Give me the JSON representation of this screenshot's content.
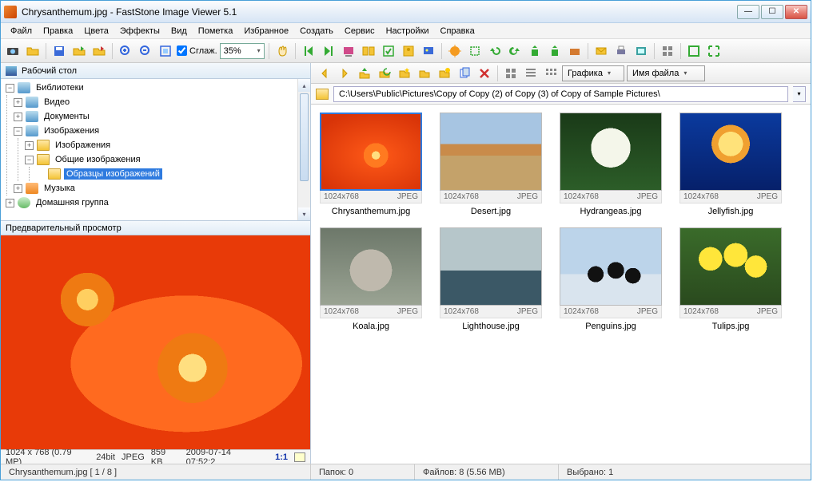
{
  "title": "Chrysanthemum.jpg  -  FastStone Image Viewer 5.1",
  "menu": [
    "Файл",
    "Правка",
    "Цвета",
    "Эффекты",
    "Вид",
    "Пометка",
    "Избранное",
    "Создать",
    "Сервис",
    "Настройки",
    "Справка"
  ],
  "toolbar": {
    "smooth_label": "Сглаж.",
    "zoom_pct": "35%"
  },
  "tree": {
    "root": "Рабочий стол",
    "lib": "Библиотеки",
    "video": "Видео",
    "docs": "Документы",
    "images": "Изображения",
    "images2": "Изображения",
    "shared_images": "Общие изображения",
    "samples": "Образцы изображений",
    "music": "Музыка",
    "homegroup": "Домашняя группа"
  },
  "preview_header": "Предварительный просмотр",
  "info": {
    "dims": "1024 x 768 (0.79 MP)",
    "depth": "24bit",
    "fmt": "JPEG",
    "size": "859 KB",
    "date": "2009-07-14 07:52:2",
    "ratio": "1:1"
  },
  "right_toolbar": {
    "view_combo": "Графика",
    "sort_combo": "Имя файла"
  },
  "address": "C:\\Users\\Public\\Pictures\\Copy of Copy (2) of Copy (3) of Copy of Sample Pictures\\",
  "thumbs": [
    {
      "name": "Chrysanthemum.jpg",
      "dims": "1024x768",
      "fmt": "JPEG",
      "bg": "bg-chrys",
      "sel": true
    },
    {
      "name": "Desert.jpg",
      "dims": "1024x768",
      "fmt": "JPEG",
      "bg": "bg-desert"
    },
    {
      "name": "Hydrangeas.jpg",
      "dims": "1024x768",
      "fmt": "JPEG",
      "bg": "bg-hydr"
    },
    {
      "name": "Jellyfish.jpg",
      "dims": "1024x768",
      "fmt": "JPEG",
      "bg": "bg-jelly"
    },
    {
      "name": "Koala.jpg",
      "dims": "1024x768",
      "fmt": "JPEG",
      "bg": "bg-koala"
    },
    {
      "name": "Lighthouse.jpg",
      "dims": "1024x768",
      "fmt": "JPEG",
      "bg": "bg-light"
    },
    {
      "name": "Penguins.jpg",
      "dims": "1024x768",
      "fmt": "JPEG",
      "bg": "bg-peng"
    },
    {
      "name": "Tulips.jpg",
      "dims": "1024x768",
      "fmt": "JPEG",
      "bg": "bg-tulip"
    }
  ],
  "status": {
    "current": "Chrysanthemum.jpg  [ 1 / 8 ]",
    "folders": "Папок: 0",
    "files": "Файлов: 8 (5.56 MB)",
    "selected": "Выбрано: 1"
  },
  "icons": {
    "camera": "#3a7a3a",
    "open": "#f4c437",
    "save": "#3a6ad8",
    "copy": "#f4c437",
    "move": "#f4c437",
    "zoomin": "#3a6ad8",
    "zoomout": "#3a6ad8",
    "fit": "#3a6ad8",
    "actual": "#3a6ad8",
    "hand": "#d4a040",
    "prev": "#3aa040",
    "next": "#3aa040",
    "slide": "#d04a8a",
    "compare": "#f4c437",
    "tag": "#3aa040",
    "mail": "#f4c437",
    "wall": "#3a6ad8",
    "sun": "#f49a20",
    "crop": "#3aa040",
    "undo": "#3aa040",
    "redo": "#3aa040",
    "rotl": "#3aa040",
    "rotr": "#3aa040",
    "resize": "#d47a30",
    "mail2": "#f4c437",
    "print": "#7878a0",
    "scan": "#3aa0a0",
    "settings": "#888",
    "full": "#3aa040",
    "full2": "#3aa040",
    "back": "#f4c437",
    "fwd": "#f4c437",
    "up": "#f4c437",
    "home": "#f4c437",
    "fav": "#f4c437",
    "fav2": "#f4c437",
    "newfold": "#f4c437",
    "copy2": "#3a6ad8",
    "del": "#d03030",
    "v1": "#888",
    "v2": "#888",
    "v3": "#888"
  }
}
